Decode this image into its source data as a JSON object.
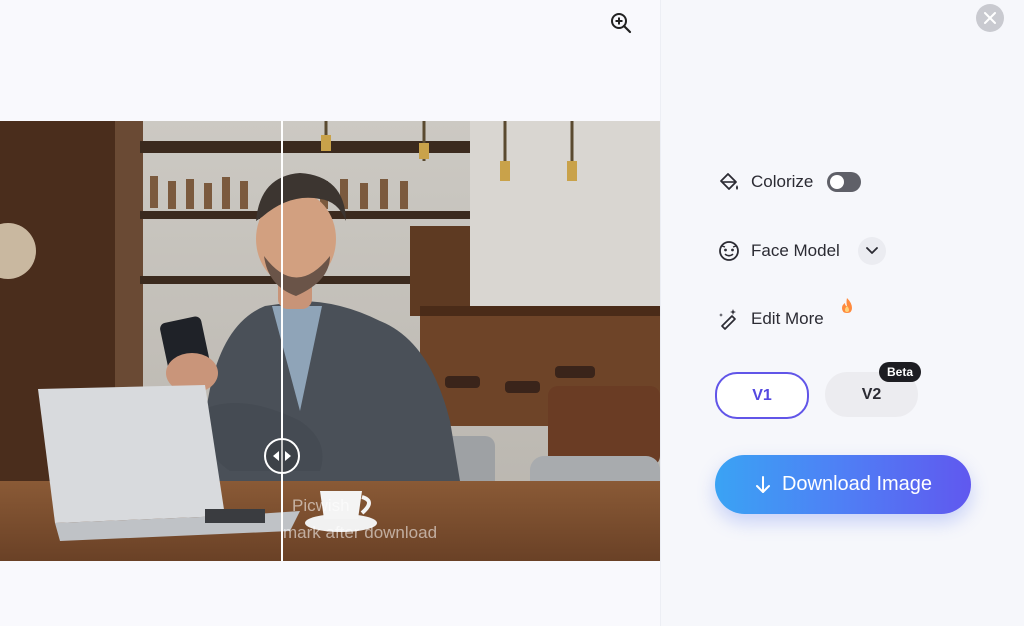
{
  "toolbar": {
    "zoom_icon": "zoom-in-icon",
    "close_icon": "close-icon"
  },
  "preview": {
    "watermark_line1": "Picwish",
    "watermark_line2": "mark after download",
    "compare_handle_icon": "compare-slider-icon"
  },
  "options": {
    "colorize": {
      "label": "Colorize",
      "icon": "paint-bucket-icon",
      "enabled": false
    },
    "face_model": {
      "label": "Face Model",
      "icon": "face-icon",
      "dropdown_icon": "chevron-down-icon"
    },
    "edit_more": {
      "label": "Edit More",
      "icon": "magic-wand-icon",
      "badge_icon": "fire-icon"
    }
  },
  "versions": {
    "v1_label": "V1",
    "v2_label": "V2",
    "v2_badge": "Beta",
    "selected": "V1"
  },
  "download": {
    "label": "Download Image",
    "icon": "download-arrow-icon"
  },
  "colors": {
    "accent": "#5448e0",
    "button_start": "#3aa3f4",
    "button_end": "#6058ef"
  }
}
